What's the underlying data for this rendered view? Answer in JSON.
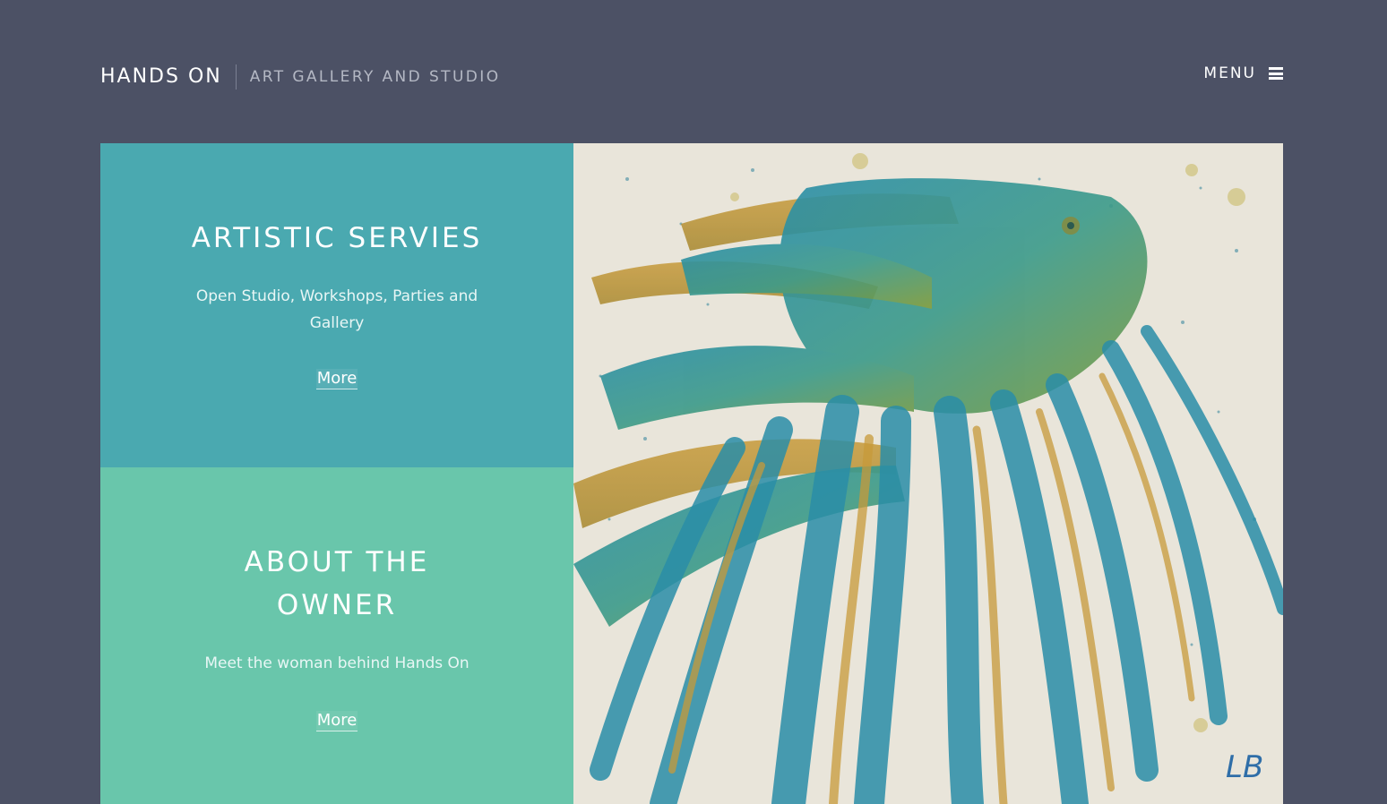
{
  "header": {
    "site_title": "HANDS ON",
    "tagline": "ART GALLERY AND STUDIO",
    "menu_label": "MENU",
    "menu_icon": "hamburger-icon"
  },
  "panels": [
    {
      "title": "ARTISTIC SERVIES",
      "description": "Open Studio, Workshops, Parties and Gallery",
      "link_label": "More",
      "color": "#4aa9b0"
    },
    {
      "title": "ABOUT THE OWNER",
      "description": "Meet the woman behind Hands On",
      "link_label": "More",
      "color": "#69c6ab"
    }
  ],
  "artwork": {
    "subject": "watercolor-fish-painting",
    "signature": "LB"
  },
  "colors": {
    "background": "#4c5165",
    "teal": "#4aa9b0",
    "mint": "#69c6ab"
  }
}
